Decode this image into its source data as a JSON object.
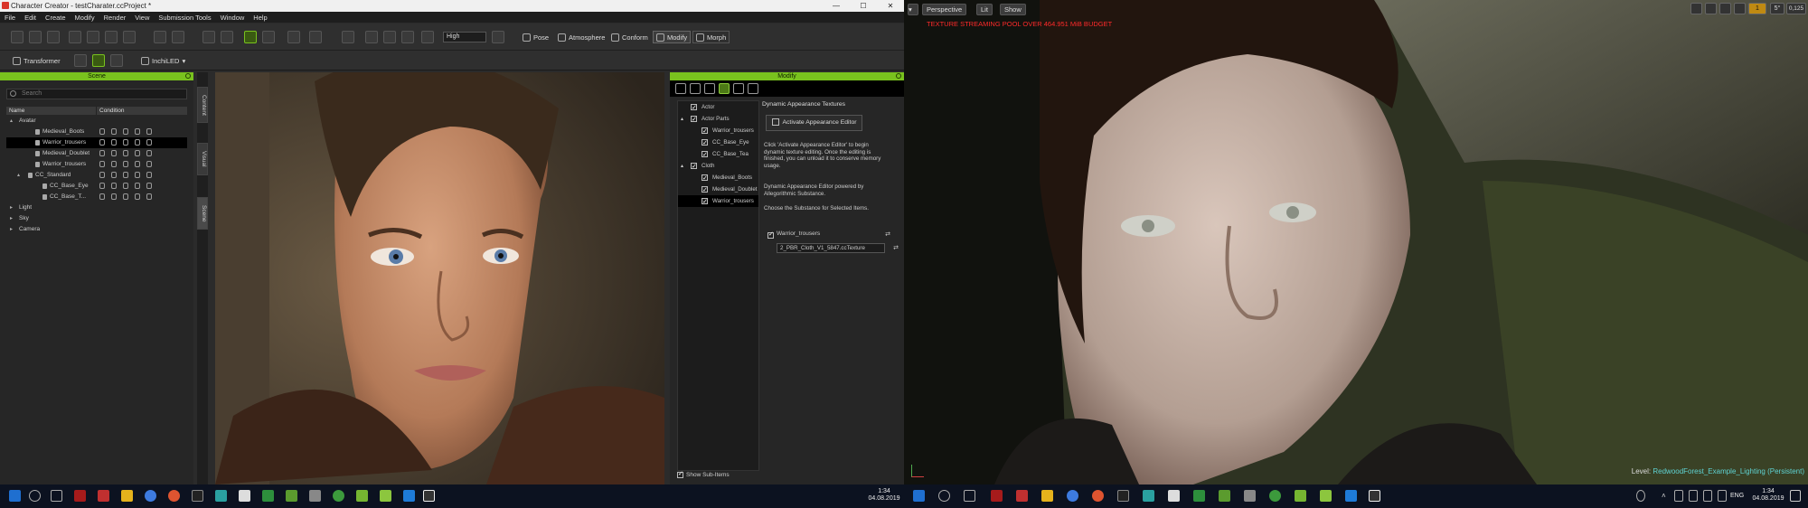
{
  "left_window": {
    "title": "Character Creator - testCharater.ccProject *",
    "menu": [
      "File",
      "Edit",
      "Create",
      "Modify",
      "Render",
      "View",
      "Submission Tools",
      "Window",
      "Help"
    ],
    "quality_select": "High",
    "mode_tabs": [
      "Pose",
      "Atmosphere",
      "Conform",
      "Modify",
      "Morph"
    ],
    "toolbar2": {
      "transformer": "Transformer",
      "inchild": "InchiLED"
    }
  },
  "scene": {
    "header": "Scene",
    "search_placeholder": "Search",
    "columns": [
      "Name",
      "Condition"
    ],
    "tree": [
      {
        "label": "Avatar",
        "indent": 0,
        "expander": "▴"
      },
      {
        "label": "Medieval_Boots",
        "indent": 2
      },
      {
        "label": "Warrior_trousers",
        "indent": 2,
        "selected": true
      },
      {
        "label": "Medieval_Doublet",
        "indent": 2
      },
      {
        "label": "Warrior_trousers",
        "indent": 2
      },
      {
        "label": "CC_Standard",
        "indent": 1,
        "expander": "▴"
      },
      {
        "label": "CC_Base_Eye",
        "indent": 3
      },
      {
        "label": "CC_Base_T...",
        "indent": 3
      },
      {
        "label": "Light",
        "indent": 0,
        "expander": "▸"
      },
      {
        "label": "Sky",
        "indent": 0,
        "expander": "▸"
      },
      {
        "label": "Camera",
        "indent": 0,
        "expander": "▸"
      }
    ],
    "side_tabs": [
      "Content",
      "Visual",
      "Scene"
    ]
  },
  "modify": {
    "header": "Modify",
    "tree": [
      {
        "label": "Actor",
        "indent": 1
      },
      {
        "label": "Actor Parts",
        "indent": 1,
        "expander": "▴"
      },
      {
        "label": "Warrior_trousers",
        "indent": 2
      },
      {
        "label": "CC_Base_Eye",
        "indent": 2
      },
      {
        "label": "CC_Base_Tea",
        "indent": 2
      },
      {
        "label": "Cloth",
        "indent": 1,
        "expander": "▴"
      },
      {
        "label": "Medieval_Boots",
        "indent": 2
      },
      {
        "label": "Medieval_Doublet",
        "indent": 2
      },
      {
        "label": "Warrior_trousers",
        "indent": 2,
        "selected": true
      }
    ],
    "dyn_title": "Dynamic Appearance Textures",
    "activate_button": "Activate Appearance Editor",
    "para1": "Click 'Activate Appearance Editor' to begin dynamic texture editing. Once the editing is finished, you can unload it to conserve memory usage.",
    "para2": "Dynamic Appearance Editor powered by Allegorithmic Substance.",
    "para3": "Choose the Substance for Selected Items.",
    "substance_item": "Warrior_trousers",
    "substance_file": "2_PBR_Cloth_V1_5847.ccTexture",
    "show_sub": "Show Sub-Items"
  },
  "left_taskbar": {
    "time": "1:34",
    "date": "04.08.2019"
  },
  "right_window": {
    "buttons": [
      "Perspective",
      "Lit",
      "Show"
    ],
    "warning": "TEXTURE STREAMING POOL OVER 464.951 MiB BUDGET",
    "toolbar_values": [
      "1",
      "5°",
      "0,125",
      "4"
    ],
    "level_label": "Level:",
    "level_name": "RedwoodForest_Example_Lighting (Persistent)"
  },
  "right_taskbar": {
    "lang": "ENG",
    "time": "1:34",
    "date": "04.08.2019"
  }
}
